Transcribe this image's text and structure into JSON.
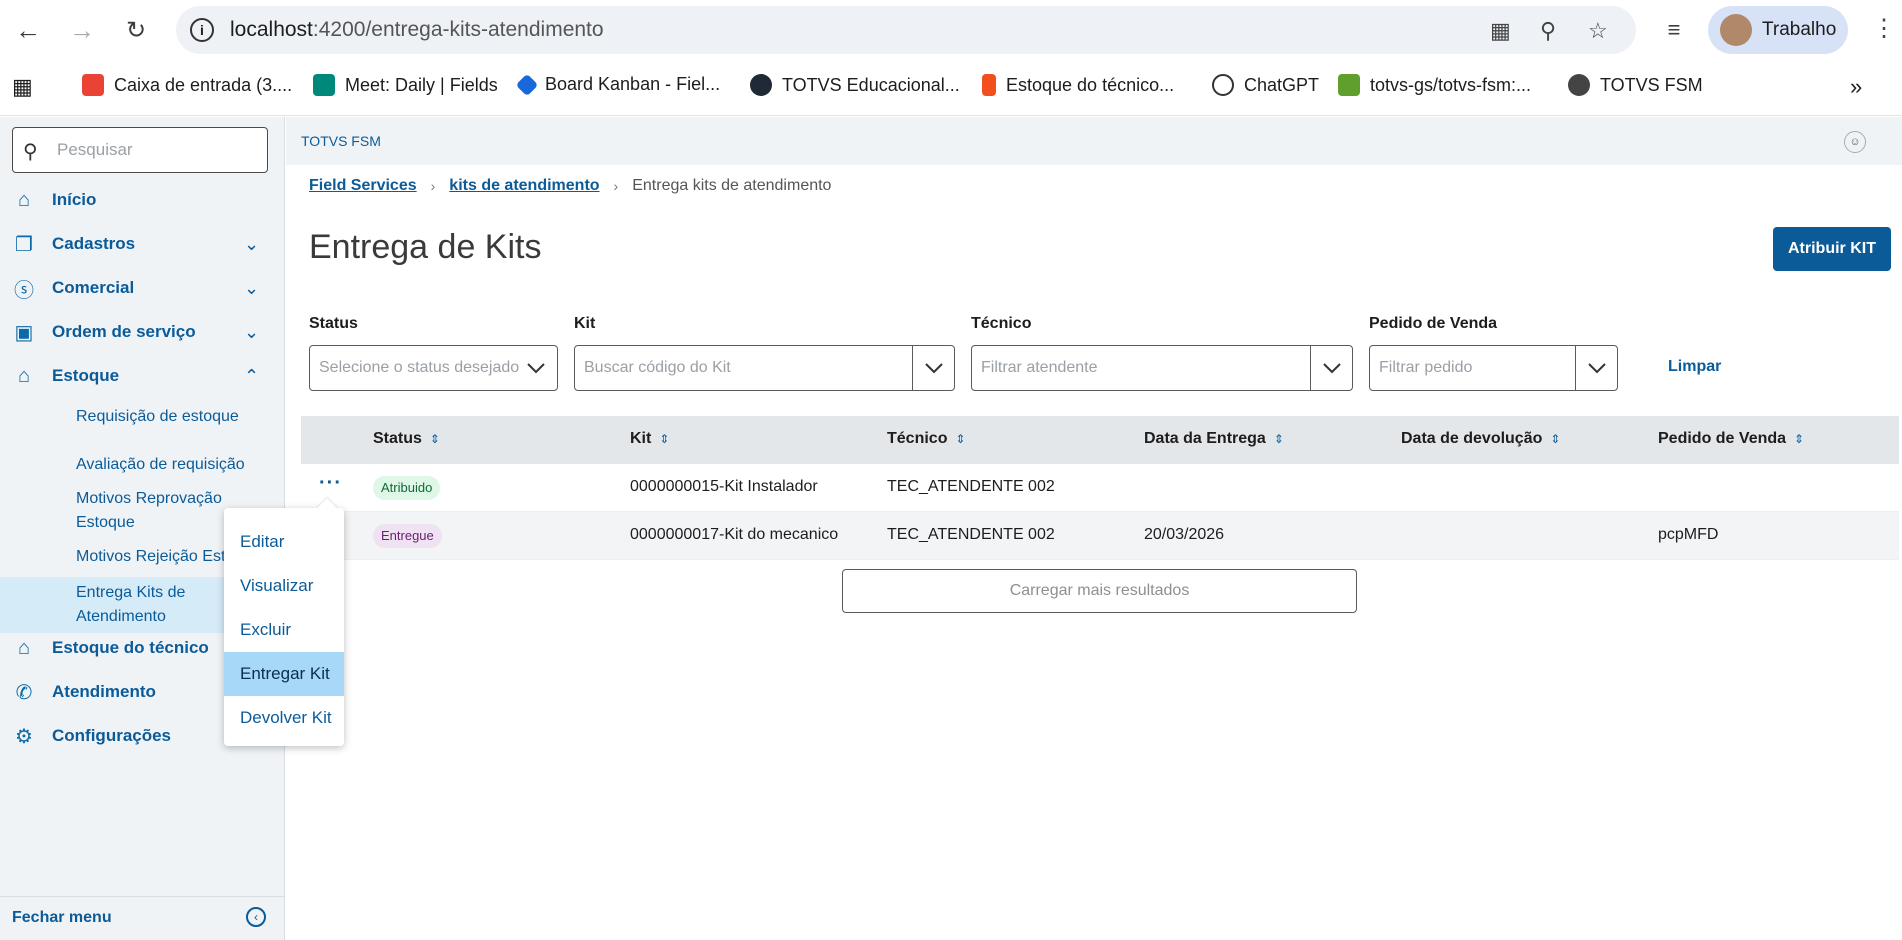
{
  "browser": {
    "url_host": "localhost",
    "url_path": ":4200/entrega-kits-atendimento",
    "profile_name": "Trabalho",
    "bookmarks": [
      {
        "label": "Caixa de entrada (3....",
        "color": "#ea4335"
      },
      {
        "label": "Meet: Daily | Fields",
        "color": "#00897b"
      },
      {
        "label": "Board Kanban - Fiel...",
        "color": "#1868db"
      },
      {
        "label": "TOTVS Educacional...",
        "color": "#1f2a36"
      },
      {
        "label": "Estoque do técnico...",
        "color": "#f24e1e"
      },
      {
        "label": "ChatGPT",
        "color": "#333333"
      },
      {
        "label": "totvs-gs/totvs-fsm:...",
        "color": "#5e9f2e"
      },
      {
        "label": "TOTVS FSM",
        "color": "#444444"
      }
    ]
  },
  "sidebar": {
    "search_placeholder": "Pesquisar",
    "items": [
      {
        "label": "Início",
        "icon": "home-icon"
      },
      {
        "label": "Cadastros",
        "icon": "cards-icon"
      },
      {
        "label": "Comercial",
        "icon": "dollar-icon"
      },
      {
        "label": "Ordem de serviço",
        "icon": "toolbox-icon"
      },
      {
        "label": "Estoque",
        "icon": "warehouse-icon"
      },
      {
        "label": "Estoque do técnico",
        "icon": "warehouse-icon"
      },
      {
        "label": "Atendimento",
        "icon": "phone-icon"
      },
      {
        "label": "Configurações",
        "icon": "gear-icon"
      }
    ],
    "subitems": [
      {
        "label": "Requisição de estoque"
      },
      {
        "label": "Avaliação de requisição"
      },
      {
        "label": "Motivos Reprovação Estoque"
      },
      {
        "label": "Motivos Rejeição Est"
      },
      {
        "label": "Entrega Kits de Atendimento"
      }
    ],
    "footer_label": "Fechar menu"
  },
  "context_menu": {
    "items": [
      "Editar",
      "Visualizar",
      "Excluir",
      "Entregar Kit",
      "Devolver Kit"
    ],
    "highlighted": "Entregar Kit"
  },
  "header": {
    "brand": "TOTVS FSM"
  },
  "breadcrumb": {
    "items": [
      "Field Services",
      "kits de atendimento",
      "Entrega kits de atendimento"
    ]
  },
  "page": {
    "title": "Entrega de Kits",
    "primary_button": "Atribuir KIT"
  },
  "filters": {
    "status": {
      "label": "Status",
      "placeholder": "Selecione o status desejado"
    },
    "kit": {
      "label": "Kit",
      "placeholder": "Buscar código do Kit"
    },
    "tecnico": {
      "label": "Técnico",
      "placeholder": "Filtrar atendente"
    },
    "pedido": {
      "label": "Pedido de Venda",
      "placeholder": "Filtrar pedido"
    },
    "clear": "Limpar"
  },
  "table": {
    "columns": [
      "Status",
      "Kit",
      "Técnico",
      "Data da Entrega",
      "Data de devolução",
      "Pedido de Venda"
    ],
    "rows": [
      {
        "status": "Atribuido",
        "status_color": "#def7e6",
        "kit": "0000000015-Kit Instalador",
        "tecnico": "TEC_ATENDENTE 002",
        "data_entrega": "",
        "data_devolucao": "",
        "pedido": ""
      },
      {
        "status": "Entregue",
        "status_color": "#efe3f3",
        "kit": "0000000017-Kit do mecanico",
        "tecnico": "TEC_ATENDENTE 002",
        "data_entrega": "20/03/2026",
        "data_devolucao": "",
        "pedido": "pcpMFD"
      }
    ],
    "row_actions": "···",
    "load_more": "Carregar mais resultados"
  }
}
